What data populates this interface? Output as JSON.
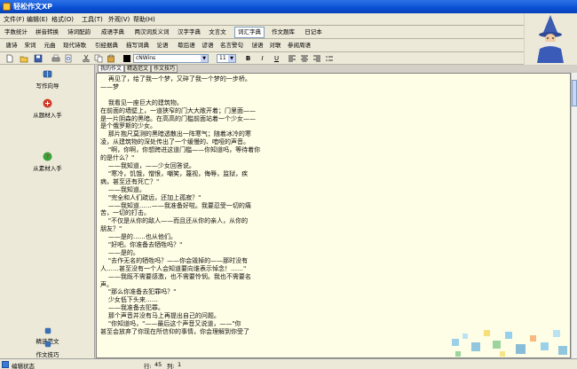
{
  "window": {
    "title": "轻松作文XP"
  },
  "menu": [
    "文件(F)",
    "编辑(E)",
    "格式(O)",
    "工具(T)",
    "外观(V)",
    "帮助(H)"
  ],
  "tabs_row1": [
    "字数统计",
    "拼音转换",
    "诗词配韵",
    "成语字典",
    "两汉词反义词",
    "汉字字典",
    "文言文",
    "词汇字典",
    "作文题库",
    "日记本"
  ],
  "tabs_row1_active": 7,
  "tabs_row2": [
    "唐诗",
    "宋词",
    "元曲",
    "现代诗歌",
    "引经据典",
    "描写词典",
    "论语",
    "歇后语",
    "谚语",
    "名言警句",
    "谜语",
    "对联",
    "参阅周语"
  ],
  "toolbar": {
    "font_name": "cNWins",
    "font_size": "11",
    "format_labels": [
      "B",
      "I",
      "U"
    ],
    "colors": {
      "text": "#000000"
    }
  },
  "sidebar": {
    "items": [
      {
        "label": "写作向导",
        "icon": "book-icon",
        "color": "#3a6fb5"
      },
      {
        "label": "从题材入手",
        "icon": "topic-icon",
        "color": "#d03a2a"
      },
      {
        "label": "从素材入手",
        "icon": "help-icon",
        "color": "#3aa33a"
      },
      {
        "label": "精选范文",
        "icon": "document-icon",
        "color": "#3a6fb5"
      },
      {
        "label": "作文技巧",
        "icon": "tips-icon",
        "color": "#3a6fb5"
      }
    ]
  },
  "doc_tabs": [
    "我的作文",
    "精选范文",
    "作文技巧"
  ],
  "doc_tabs_active": 0,
  "document": {
    "lines": [
      "    再见了，给了我一个梦，又碎了我一个梦的一步桥。",
      "——梦",
      "",
      "    我看见一座巨大的建筑物。",
      "在前面的墙壁上，一道狭窄的门大大敞开着；门里面——",
      "是一片阴森的黑暗。在高高的门槛前面站着一个少女——",
      "是个俄罗斯的少女。",
      "    那片抱尺莫测的黑暗透散出一阵寒气；随着冰冷的寒",
      "凌，从建筑物的深处传出了一个缓慢的、喑哑的声音。",
      "    \"啊，你啊，你想跨进这道门槛——你知道吗，等待着你",
      "的是什么？\"",
      "    ——我知道，——少女回答说。",
      "    \"寒冷，饥饿，憎恨，嘲笑，蔑视，侮辱，监狱，疾",
      "病，甚至还有死亡？\"",
      "    ——我知道。",
      "    \"完全和人们疏远，还加上孤寂？\"",
      "    ——我知道……——我准备好啦。我要忍受一切的痛",
      "苦，一切的打击。",
      "    \"不仅是从你的敌人——而且还从你的亲人，从你的",
      "朋友？\"",
      "    ——是的……也从他们。",
      "    \"好吧。你准备去牺牲吗？\"",
      "    ——是的。",
      "    \"去作无名的牺牲吗？——你会毁掉的——那时没有",
      "人……甚至没有一个人会知道要向谁表示悼念！……\"",
      "    ——我既不需要感激，也不需要怜悯。我也不需要名",
      "声。",
      "    \"那么你准备去犯罪吗？\"",
      "    少女低下头来……",
      "    ——我准备去犯罪。",
      "    那个声音并没有马上再提出自己的问题。",
      "    \"你知道吗，\"——最后这个声音又说道，——\"你",
      "甚至会放弃了你现在所信仰的事情，你会理解到你受了"
    ]
  },
  "status": {
    "mode": "编辑状态",
    "row_label": "行:",
    "row_value": "45",
    "col_label": "列:",
    "col_value": "1"
  }
}
